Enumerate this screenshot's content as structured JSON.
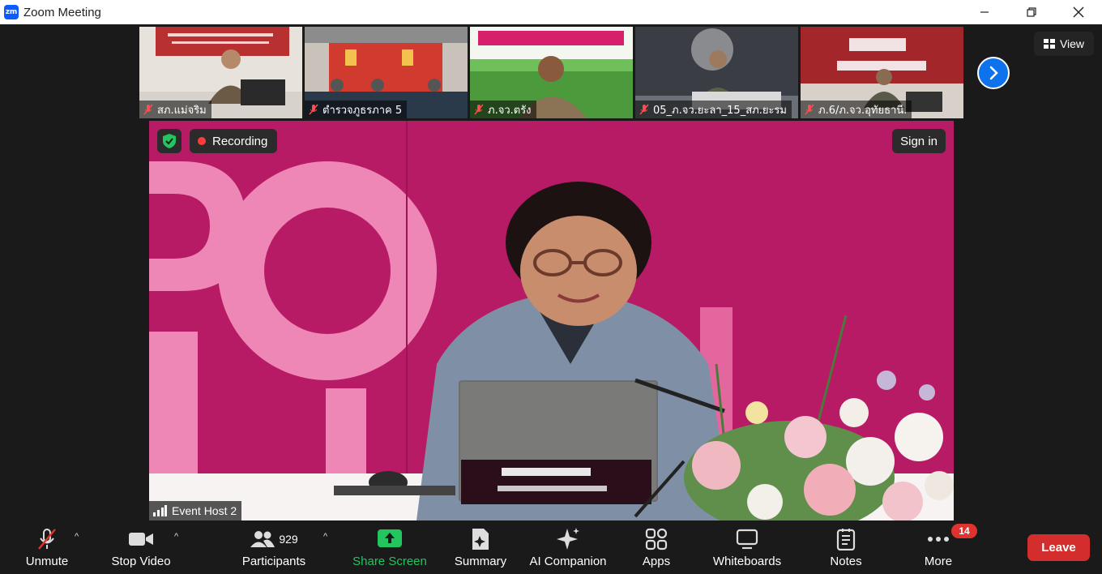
{
  "window": {
    "title": "Zoom Meeting",
    "logo_text": "zm"
  },
  "thumbnails": [
    {
      "label": "สภ.แม่จริม"
    },
    {
      "label": "ตำรวจภูธรภาค 5"
    },
    {
      "label": "ภ.จว.ตรัง"
    },
    {
      "label": "05_ภ.จว.ยะลา_15_สภ.ยะรม"
    },
    {
      "label": "ภ.6/ภ.จว.อุทัยธานี."
    }
  ],
  "view_button": {
    "label": "View"
  },
  "main_video": {
    "recording_label": "Recording",
    "sign_in_label": "Sign in",
    "host_label": "Event Host 2"
  },
  "toolbar": {
    "unmute": "Unmute",
    "stop_video": "Stop Video",
    "participants": "Participants",
    "participants_count": "929",
    "share_screen": "Share Screen",
    "summary": "Summary",
    "ai_companion": "AI Companion",
    "apps": "Apps",
    "whiteboards": "Whiteboards",
    "notes": "Notes",
    "more": "More",
    "more_badge": "14",
    "leave": "Leave"
  },
  "colors": {
    "accent_blue": "#0e72ed",
    "share_green": "#22c55e",
    "leave_red": "#d42d2d",
    "record_red": "#ff3b3b",
    "shield_green": "#22c55e"
  }
}
